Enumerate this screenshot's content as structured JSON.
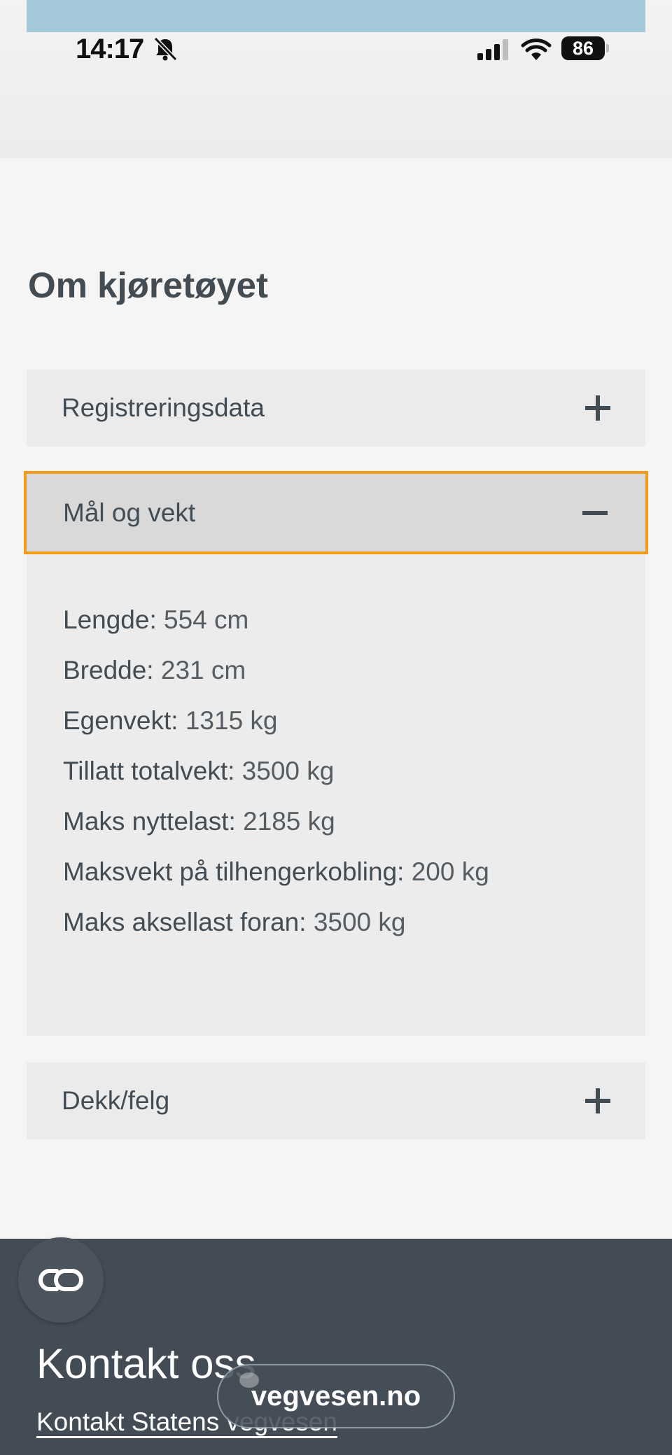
{
  "status_bar": {
    "time": "14:17",
    "battery": "86",
    "bell_icon": "bell-slash-icon",
    "signal_icon": "cellular-signal-icon",
    "wifi_icon": "wifi-icon"
  },
  "section": {
    "title": "Om kjøretøyet"
  },
  "accordion": [
    {
      "label": "Registreringsdata",
      "state": "collapsed",
      "icon": "plus-icon"
    },
    {
      "label": "Mål og vekt",
      "state": "expanded",
      "icon": "minus-icon"
    },
    {
      "label": "Dekk/felg",
      "state": "collapsed",
      "icon": "plus-icon"
    }
  ],
  "specs": [
    {
      "label": "Lengde:",
      "value": "554 cm"
    },
    {
      "label": "Bredde:",
      "value": "231 cm"
    },
    {
      "label": "Egenvekt:",
      "value": "1315 kg"
    },
    {
      "label": "Tillatt totalvekt:",
      "value": "3500 kg"
    },
    {
      "label": "Maks nyttelast:",
      "value": "2185 kg"
    },
    {
      "label": "Maksvekt på tilhengerkobling:",
      "value": "200 kg"
    },
    {
      "label": "Maks aksellast foran:",
      "value": "3500 kg"
    }
  ],
  "footer": {
    "title": "Kontakt oss",
    "link": "Kontakt Statens vegvesen",
    "fab_icon": "link-icon"
  },
  "browser": {
    "url": "vegvesen.no"
  },
  "colors": {
    "accent_focus": "#f29a1a",
    "text": "#434c53",
    "footer_bg": "#434c55"
  }
}
